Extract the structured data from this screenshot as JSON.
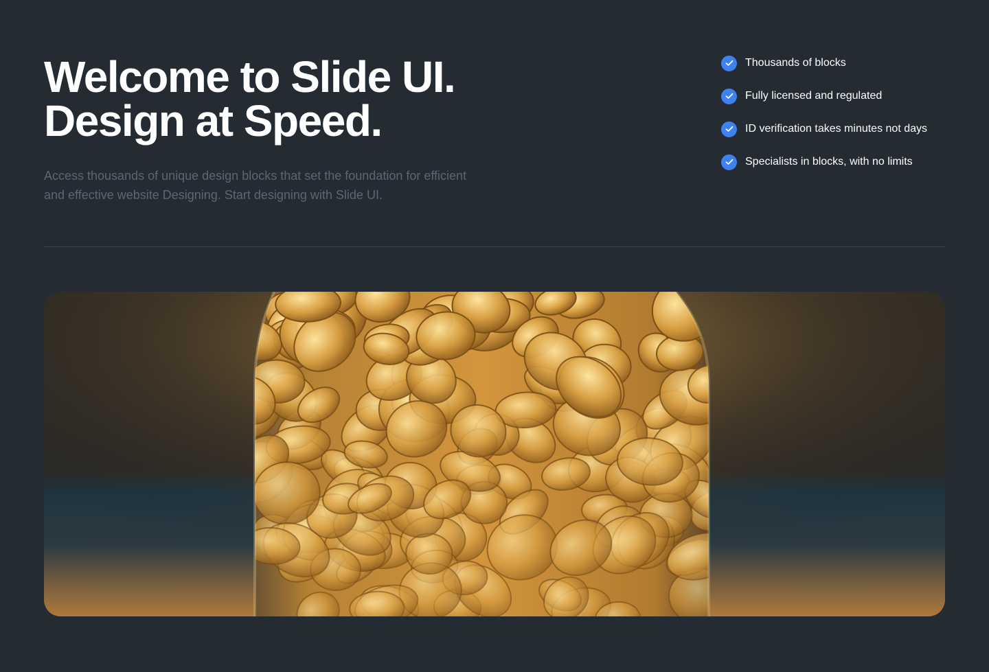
{
  "hero": {
    "title_line1": "Welcome to Slide UI.",
    "title_line2": "Design at Speed.",
    "description": "Access thousands of unique design blocks that set the foundation for efficient and effective website Designing. Start designing with Slide UI."
  },
  "features": [
    {
      "label": "Thousands of blocks",
      "icon": "check-circle-icon"
    },
    {
      "label": "Fully licensed and regulated",
      "icon": "check-circle-icon"
    },
    {
      "label": "ID verification takes minutes not days",
      "icon": "check-circle-icon"
    },
    {
      "label": "Specialists in blocks, with no limits",
      "icon": "check-circle-icon"
    }
  ],
  "image": {
    "subject": "jar-of-gold-coins"
  },
  "colors": {
    "background": "#252b33",
    "accent": "#3e82ee",
    "text": "#ffffff",
    "muted_text": "#5d6671",
    "divider": "#3a414b"
  }
}
